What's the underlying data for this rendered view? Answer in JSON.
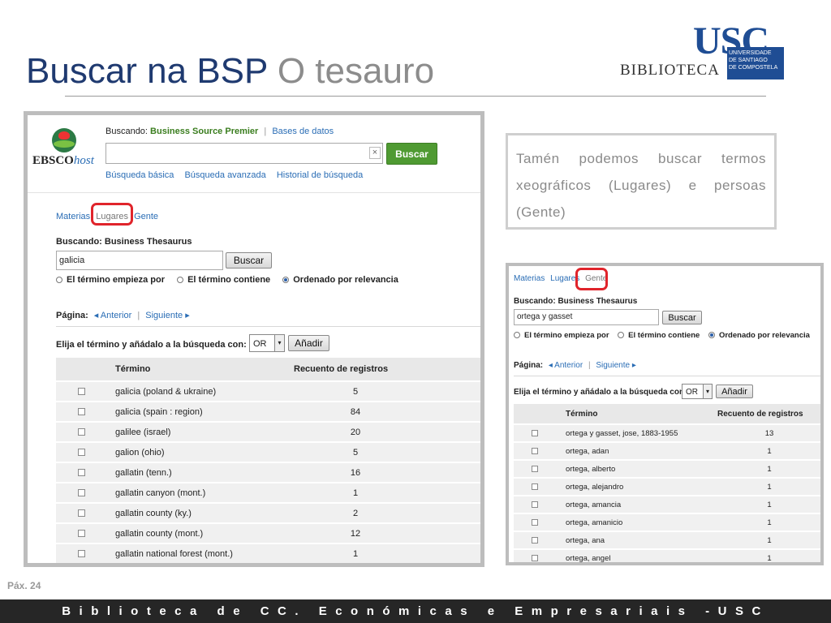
{
  "slide": {
    "title_main": "Buscar na BSP",
    "title_sub": "O tesauro",
    "page_label": "Páx.",
    "page_number": "24",
    "footer": "Biblioteca de CC. Económicas e Empresariais -USC"
  },
  "logo": {
    "usc": "USC",
    "biblioteca": "BIBLIOTECA",
    "university_lines": [
      "UNIVERSIDADE",
      "DE SANTIAGO",
      "DE COMPOSTELA"
    ]
  },
  "callout": {
    "text": "Tamén podemos buscar termos xeográficos (Lugares) e persoas (Gente)"
  },
  "ebsco": {
    "logo_text": "EBSCO",
    "logo_host": "host",
    "searching_label": "Buscando:",
    "database": "Business Source Premier",
    "databases_link": "Bases de datos",
    "search_value": "",
    "clear_symbol": "×",
    "search_button": "Buscar",
    "links": [
      "Búsqueda básica",
      "Búsqueda avanzada",
      "Historial de búsqueda"
    ]
  },
  "main": {
    "tabs": [
      "Materias",
      "Lugares",
      "Gente"
    ],
    "active_tab": "Lugares",
    "thesaurus_label": "Buscando: Business Thesaurus",
    "query": "galicia",
    "search_button": "Buscar",
    "radio_options": [
      "El término empieza por",
      "El término contiene",
      "Ordenado por relevancia"
    ],
    "radio_selected": "Ordenado por relevancia",
    "page_label": "Página:",
    "prev": "◂ Anterior",
    "next": "Siguiente ▸",
    "add_label": "Elija el término y añádalo a la búsqueda con:",
    "operator": "OR",
    "operator_arrow": "▾",
    "add_button": "Añadir",
    "columns": [
      "Término",
      "Recuento de registros"
    ],
    "rows": [
      {
        "term": "galicia (poland & ukraine)",
        "count": "5"
      },
      {
        "term": "galicia (spain : region)",
        "count": "84"
      },
      {
        "term": "galilee (israel)",
        "count": "20"
      },
      {
        "term": "galion (ohio)",
        "count": "5"
      },
      {
        "term": "gallatin (tenn.)",
        "count": "16"
      },
      {
        "term": "gallatin canyon (mont.)",
        "count": "1"
      },
      {
        "term": "gallatin county (ky.)",
        "count": "2"
      },
      {
        "term": "gallatin county (mont.)",
        "count": "12"
      },
      {
        "term": "gallatin national forest (mont.)",
        "count": "1"
      }
    ]
  },
  "second": {
    "tabs": [
      "Materias",
      "Lugares",
      "Gente"
    ],
    "active_tab": "Gente",
    "thesaurus_label": "Buscando: Business Thesaurus",
    "query": "ortega y gasset",
    "search_button": "Buscar",
    "radio_options": [
      "El término empieza por",
      "El término contiene",
      "Ordenado por relevancia"
    ],
    "radio_selected": "Ordenado por relevancia",
    "page_label": "Página:",
    "prev": "◂ Anterior",
    "next": "Siguiente ▸",
    "add_label": "Elija el término y añádalo a la búsqueda con:",
    "operator": "OR",
    "operator_arrow": "▾",
    "add_button": "Añadir",
    "columns": [
      "Término",
      "Recuento de registros"
    ],
    "rows": [
      {
        "term": "ortega y gasset, jose, 1883-1955",
        "count": "13"
      },
      {
        "term": "ortega, adan",
        "count": "1"
      },
      {
        "term": "ortega, alberto",
        "count": "1"
      },
      {
        "term": "ortega, alejandro",
        "count": "1"
      },
      {
        "term": "ortega, amancia",
        "count": "1"
      },
      {
        "term": "ortega, amanicio",
        "count": "1"
      },
      {
        "term": "ortega, ana",
        "count": "1"
      },
      {
        "term": "ortega, angel",
        "count": "1"
      }
    ]
  },
  "colors": {
    "title_blue": "#1f3a70",
    "title_gray": "#8c8c8c",
    "link_blue": "#2a6db5",
    "ebsco_green": "#4f9a32",
    "highlight_red": "#e0242b",
    "footer_bg": "#262626"
  }
}
